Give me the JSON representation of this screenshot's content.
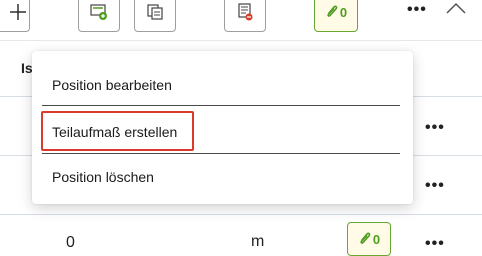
{
  "toolbar": {
    "add_icon": "plus-icon",
    "buttons": [
      {
        "name": "document-add-icon"
      },
      {
        "name": "copy-icon"
      },
      {
        "name": "document-remove-icon"
      }
    ],
    "attachments_count": "0",
    "more_label": "•••",
    "collapse_icon": "chevron-up-icon"
  },
  "table": {
    "column_header": "Is",
    "row_more_label": "•••",
    "row_attachments_count": "0",
    "bottom_partial_1": "0",
    "bottom_partial_2": "m"
  },
  "context_menu": {
    "items": [
      {
        "label": "Position bearbeiten"
      },
      {
        "label": "Teilaufmaß erstellen"
      },
      {
        "label": "Position löschen"
      }
    ],
    "highlight_color": "#d93a2b"
  },
  "colors": {
    "accent_green": "#4d9d1f",
    "border": "#9e9e9e",
    "row_divider": "#d7dee4"
  }
}
